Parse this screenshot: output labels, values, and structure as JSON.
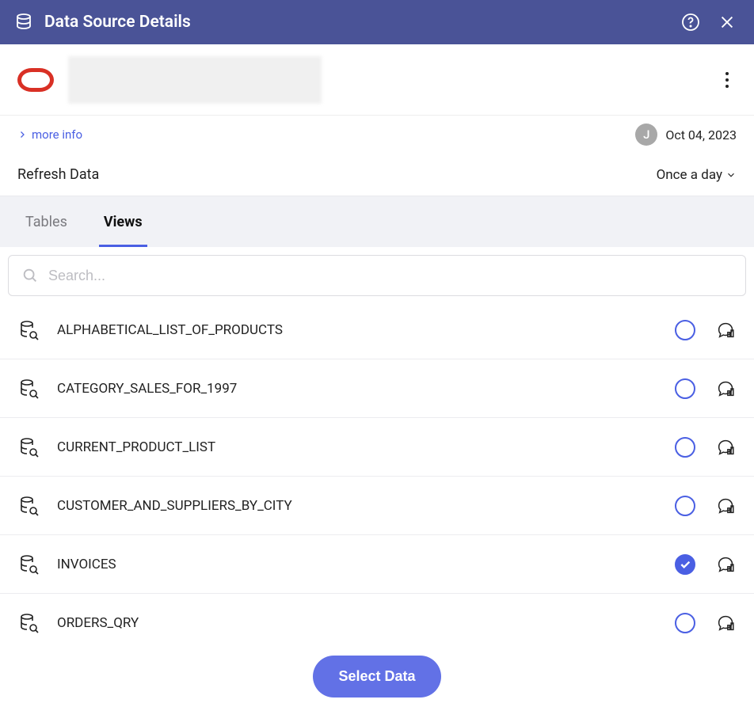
{
  "header": {
    "title": "Data Source Details"
  },
  "source": {
    "more_info_label": "more info",
    "avatar_initial": "J",
    "date": "Oct 04, 2023"
  },
  "refresh": {
    "label": "Refresh Data",
    "frequency": "Once a day"
  },
  "tabs": {
    "tables_label": "Tables",
    "views_label": "Views",
    "active": "views"
  },
  "search": {
    "placeholder": "Search..."
  },
  "views": [
    {
      "name": "ALPHABETICAL_LIST_OF_PRODUCTS",
      "selected": false
    },
    {
      "name": "CATEGORY_SALES_FOR_1997",
      "selected": false
    },
    {
      "name": "CURRENT_PRODUCT_LIST",
      "selected": false
    },
    {
      "name": "CUSTOMER_AND_SUPPLIERS_BY_CITY",
      "selected": false
    },
    {
      "name": "INVOICES",
      "selected": true
    },
    {
      "name": "ORDERS_QRY",
      "selected": false
    }
  ],
  "footer": {
    "select_label": "Select Data"
  }
}
